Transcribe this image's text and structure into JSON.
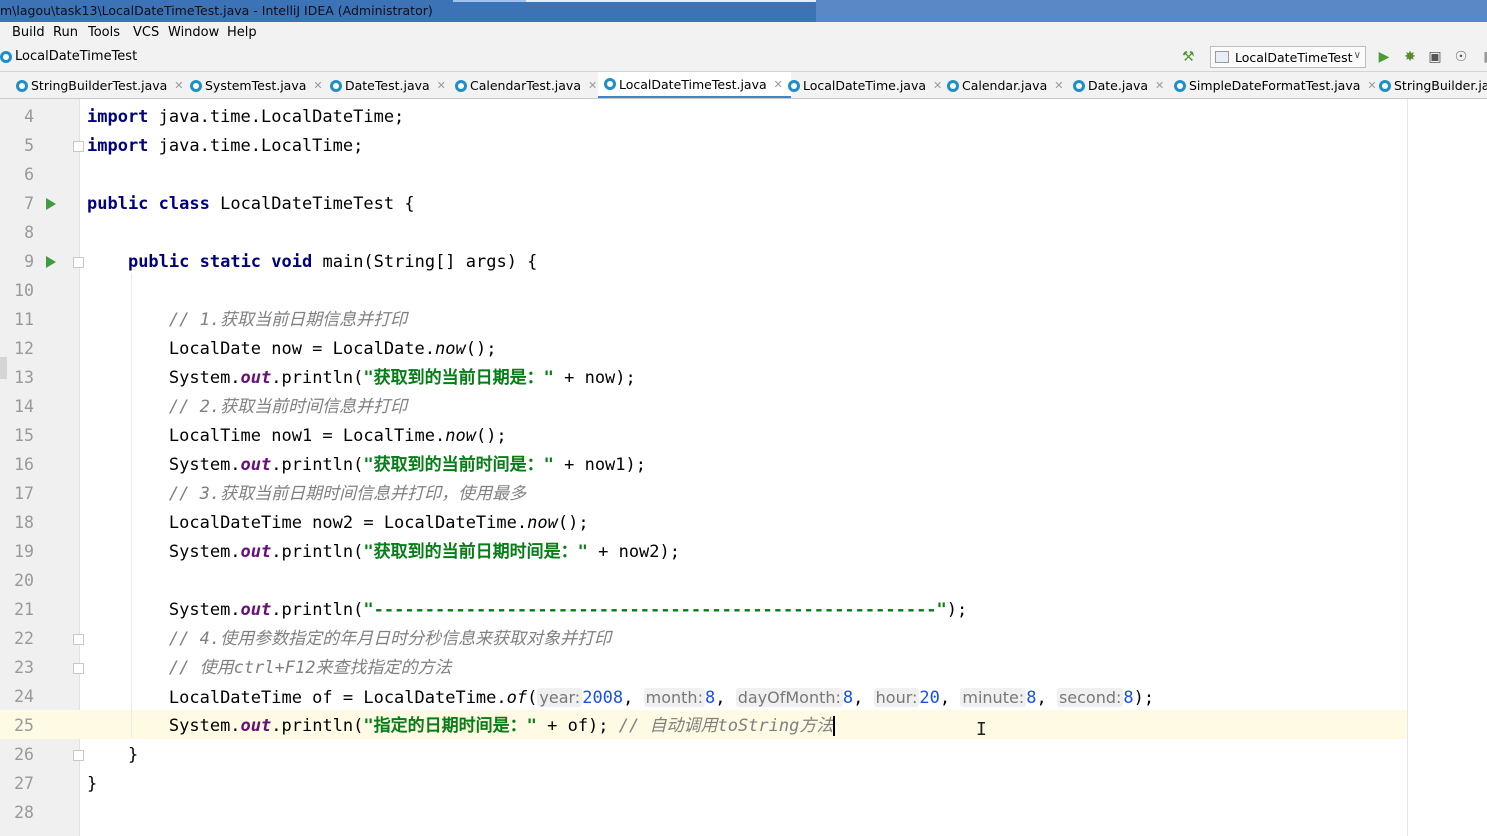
{
  "window": {
    "title": "m\\lagou\\task13\\LocalDateTimeTest.java - IntelliJ IDEA (Administrator)"
  },
  "menu": [
    "Build",
    "Run",
    "Tools",
    "VCS",
    "Window",
    "Help"
  ],
  "nav": {
    "breadcrumb": "LocalDateTimeTest",
    "run_config": "LocalDateTimeTest"
  },
  "tabs": [
    {
      "label": "StringBuilderTest.java",
      "active": false
    },
    {
      "label": "SystemTest.java",
      "active": false
    },
    {
      "label": "DateTest.java",
      "active": false
    },
    {
      "label": "CalendarTest.java",
      "active": false
    },
    {
      "label": "LocalDateTimeTest.java",
      "active": true
    },
    {
      "label": "LocalDateTime.java",
      "active": false
    },
    {
      "label": "Calendar.java",
      "active": false
    },
    {
      "label": "Date.java",
      "active": false
    },
    {
      "label": "SimpleDateFormatTest.java",
      "active": false
    },
    {
      "label": "StringBuilder.jav",
      "active": false
    }
  ],
  "editor": {
    "line_numbers": [
      "4",
      "5",
      "6",
      "7",
      "8",
      "9",
      "10",
      "11",
      "12",
      "13",
      "14",
      "15",
      "16",
      "17",
      "18",
      "19",
      "20",
      "21",
      "22",
      "23",
      "24",
      "25",
      "26",
      "27",
      "28"
    ],
    "current_line": "25",
    "code": {
      "l4": {
        "kw": "import",
        "rest": " java.time.LocalDateTime;"
      },
      "l5": {
        "kw": "import",
        "rest": " java.time.LocalTime;"
      },
      "l7": {
        "kw1": "public",
        "kw2": "class",
        "rest": " LocalDateTimeTest {"
      },
      "l9": {
        "kw1": "public",
        "kw2": "static",
        "kw3": "void",
        "rest": " main(String[] args) {"
      },
      "l11": {
        "comment": "// 1.获取当前日期信息并打印"
      },
      "l12": {
        "a": "LocalDate now = LocalDate.",
        "method": "now",
        "b": "();"
      },
      "l13": {
        "a": "System.",
        "field": "out",
        "b": ".println(",
        "str": "\"获取到的当前日期是：\"",
        "c": " + now);"
      },
      "l14": {
        "comment": "// 2.获取当前时间信息并打印"
      },
      "l15": {
        "a": "LocalTime now1 = LocalTime.",
        "method": "now",
        "b": "();"
      },
      "l16": {
        "a": "System.",
        "field": "out",
        "b": ".println(",
        "str": "\"获取到的当前时间是：\"",
        "c": " + now1);"
      },
      "l17": {
        "comment": "// 3.获取当前日期时间信息并打印，使用最多"
      },
      "l18": {
        "a": "LocalDateTime now2 = LocalDateTime.",
        "method": "now",
        "b": "();"
      },
      "l19": {
        "a": "System.",
        "field": "out",
        "b": ".println(",
        "str": "\"获取到的当前日期时间是：\"",
        "c": " + now2);"
      },
      "l21": {
        "a": "System.",
        "field": "out",
        "b": ".println(",
        "str": "\"-------------------------------------------------------\"",
        "c": ");"
      },
      "l22": {
        "comment": "// 4.使用参数指定的年月日时分秒信息来获取对象并打印"
      },
      "l23": {
        "comment": "// 使用ctrl+F12来查找指定的方法"
      },
      "l24": {
        "a": "LocalDateTime of = LocalDateTime.",
        "method": "of",
        "b": "(",
        "h_year": "year:",
        "v_year": "2008",
        "h_month": "month:",
        "v_month": "8",
        "h_day": "dayOfMonth:",
        "v_day": "8",
        "h_hour": "hour:",
        "v_hour": "20",
        "h_minute": "minute:",
        "v_minute": "8",
        "h_second": "second:",
        "v_second": "8",
        "comma": ", ",
        "end": ");"
      },
      "l25": {
        "a": "System.",
        "field": "out",
        "b": ".println(",
        "str": "\"指定的日期时间是：\"",
        "c": " + of); ",
        "comment": "// 自动调用toString方法"
      },
      "l26": {
        "text": "}"
      },
      "l27": {
        "text": "}"
      }
    }
  }
}
